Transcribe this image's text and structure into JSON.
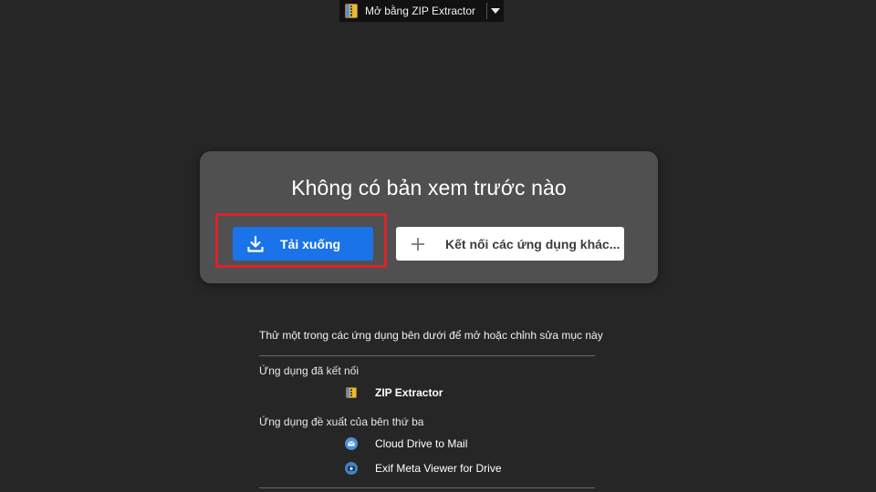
{
  "toolbar": {
    "open_with_label": "Mở bằng ZIP Extractor",
    "open_with_icon": "zip-extractor-icon",
    "dropdown_icon": "caret-down-icon"
  },
  "preview": {
    "title": "Không có bản xem trước nào",
    "download_label": "Tải xuống",
    "download_icon": "download-icon",
    "connect_label": "Kết nối các ứng dụng khác...",
    "connect_icon": "plus-icon",
    "highlight_color": "#d9232a",
    "accent_color": "#1a73e8"
  },
  "suggestions": {
    "intro": "Thử một trong các ứng dụng bên dưới để mở hoặc chỉnh sửa mục này",
    "connected_label": "Ứng dụng đã kết nối",
    "connected_apps": [
      {
        "name": "ZIP Extractor",
        "icon": "zip-extractor-icon"
      }
    ],
    "third_party_label": "Ứng dụng đề xuất của bên thứ ba",
    "third_party_apps": [
      {
        "name": "Cloud Drive to Mail",
        "icon": "mail-icon"
      },
      {
        "name": "Exif Meta Viewer for Drive",
        "icon": "camera-icon"
      }
    ]
  }
}
